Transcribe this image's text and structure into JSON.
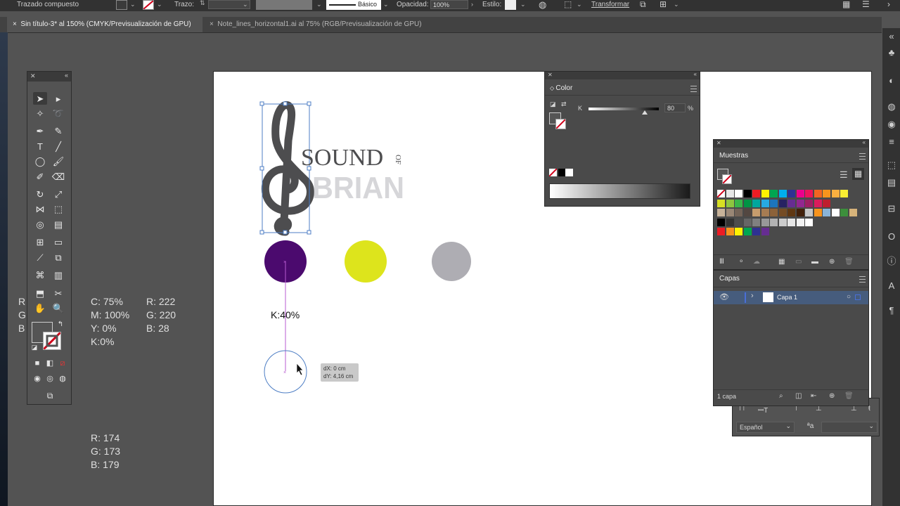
{
  "control_bar": {
    "object_type": "Trazado compuesto",
    "stroke_label": "Trazo:",
    "brush_label": "Básico",
    "opacity_label": "Opacidad:",
    "opacity_value": "100%",
    "style_label": "Estilo:",
    "transform_label": "Transformar"
  },
  "tabs": [
    {
      "label": "Sin título-3* al 150% (CMYK/Previsualización de GPU)",
      "close": "×"
    },
    {
      "label": "Note_lines_horizontal1.ai al 75% (RGB/Previsualización de GPU)",
      "close": "×"
    }
  ],
  "canvas": {
    "logo": {
      "word1": "SOUND",
      "word2": "OF",
      "word3": "BRIAN"
    },
    "circles": [
      {
        "name": "purple",
        "color": "#4b0a6e"
      },
      {
        "name": "yellow",
        "color": "#dde41c"
      },
      {
        "name": "gray",
        "color": "#aeadb3"
      }
    ],
    "k_label": "K:40%",
    "tooltip": {
      "dx": "dX: 0 cm",
      "dy": "dY: 4,16 cm"
    }
  },
  "notes": {
    "cmyk": [
      "C: 75%",
      "M: 100%",
      "Y: 0%",
      "K:0%"
    ],
    "rgb_yellow": [
      "R: 222",
      "G: 220",
      "B: 28"
    ],
    "rgb_gray": [
      "R: 174",
      "G: 173",
      "B: 179"
    ],
    "clipped_left": [
      "R",
      "G",
      "B"
    ]
  },
  "color_panel": {
    "title": "Color",
    "channel": "K",
    "value": "80",
    "unit": "%",
    "level": 0.8
  },
  "swatches_panel": {
    "title": "Muestras",
    "rows": [
      [
        "#ffffff",
        "#e6e6e6",
        "#ffffff",
        "#000000",
        "#ed1c24",
        "#fff200",
        "#00a651",
        "#00aeef",
        "#2e3192",
        "#ec008c",
        "#ed145b",
        "#f26522",
        "#f7941d",
        "#fbb040",
        "#f9ed32"
      ],
      [
        "#d7df23",
        "#8dc63f",
        "#39b54a",
        "#009444",
        "#00a79d",
        "#27aae1",
        "#1c75bc",
        "#262262",
        "#662d91",
        "#92278f",
        "#9e1f63",
        "#da1c5c",
        "#be1e2d"
      ],
      [
        "#c7b299",
        "#998675",
        "#736357",
        "#534741",
        "#c69c6d",
        "#a67c52",
        "#8c6239",
        "#754c24",
        "#603813",
        "#42210b",
        "#c5c5c5",
        "#f7941d",
        "#8ab4d8",
        "#ffffff",
        "#3d8f3c",
        "#d6b37a"
      ],
      [
        "#000000",
        "#333333",
        "#4d4d4d",
        "#666666",
        "#808080",
        "#999999",
        "#b3b3b3",
        "#cccccc",
        "#e6e6e6",
        "#f2f2f2",
        "#ffffff"
      ],
      [
        "#ed1c24",
        "#f7941d",
        "#fff200",
        "#00a651",
        "#2e3192",
        "#662d91"
      ]
    ]
  },
  "layers_panel": {
    "title": "Capas",
    "layer_name": "Capa 1",
    "count": "1 capa"
  },
  "character_panel": {
    "language": "Español",
    "aa_label": "ªa"
  },
  "colors": {
    "accent": "#4a6fd6",
    "canvas_bg": "#535353",
    "selection_blue": "#4c7dc4",
    "guide_magenta": "#b75bd0"
  }
}
